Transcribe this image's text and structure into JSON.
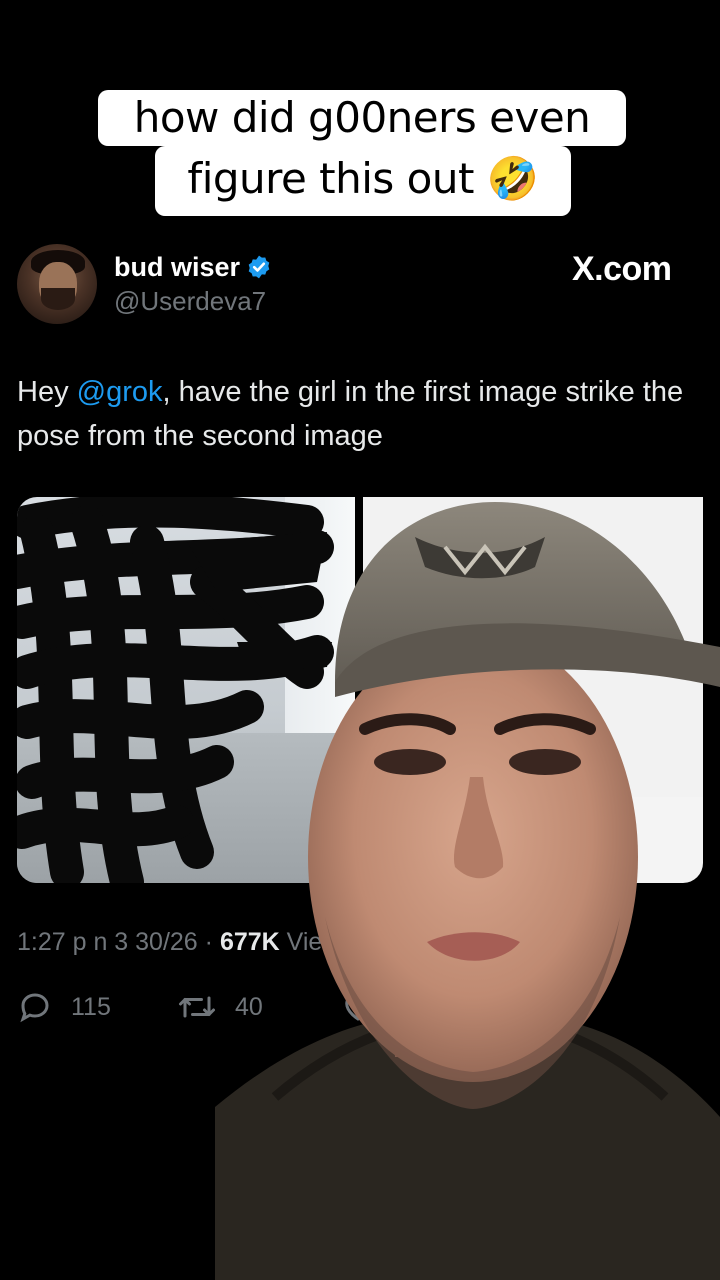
{
  "caption": {
    "line1": "how did g00ners even",
    "line2": "figure this out 🤣"
  },
  "tweet": {
    "display_name": "bud wiser",
    "handle": "@Userdeva7",
    "site": "X.com",
    "text_prefix": "Hey ",
    "mention": "@grok",
    "text_suffix": ", have the girl in the first image strike the pose from the second image",
    "timestamp": "1:27 p n  3  30/26 · ",
    "views_count": "677K",
    "views_label": " Views",
    "replies": "115",
    "reposts": "40"
  },
  "colors": {
    "accent": "#1d9bf0",
    "muted": "#71767b",
    "background": "#000000"
  },
  "icons": {
    "verified": "verified-badge-icon",
    "reply": "reply-icon",
    "repost": "repost-icon",
    "like": "heart-icon"
  }
}
